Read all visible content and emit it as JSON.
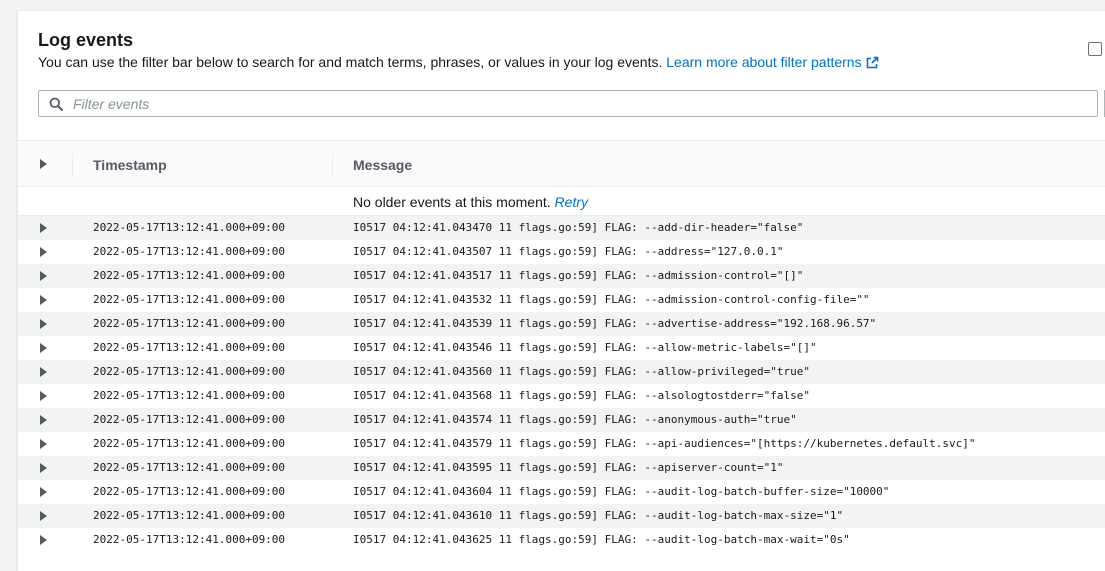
{
  "header": {
    "title": "Log events",
    "description": "You can use the filter bar below to search for and match terms, phrases, or values in your log events.",
    "learn_more": "Learn more about filter patterns"
  },
  "filter": {
    "placeholder": "Filter events",
    "value": ""
  },
  "table": {
    "columns": [
      "Timestamp",
      "Message"
    ],
    "notice": "No older events at this moment.",
    "retry": "Retry",
    "rows": [
      {
        "timestamp": "2022-05-17T13:12:41.000+09:00",
        "message": "I0517 04:12:41.043470 11 flags.go:59] FLAG: --add-dir-header=\"false\""
      },
      {
        "timestamp": "2022-05-17T13:12:41.000+09:00",
        "message": "I0517 04:12:41.043507 11 flags.go:59] FLAG: --address=\"127.0.0.1\""
      },
      {
        "timestamp": "2022-05-17T13:12:41.000+09:00",
        "message": "I0517 04:12:41.043517 11 flags.go:59] FLAG: --admission-control=\"[]\""
      },
      {
        "timestamp": "2022-05-17T13:12:41.000+09:00",
        "message": "I0517 04:12:41.043532 11 flags.go:59] FLAG: --admission-control-config-file=\"\""
      },
      {
        "timestamp": "2022-05-17T13:12:41.000+09:00",
        "message": "I0517 04:12:41.043539 11 flags.go:59] FLAG: --advertise-address=\"192.168.96.57\""
      },
      {
        "timestamp": "2022-05-17T13:12:41.000+09:00",
        "message": "I0517 04:12:41.043546 11 flags.go:59] FLAG: --allow-metric-labels=\"[]\""
      },
      {
        "timestamp": "2022-05-17T13:12:41.000+09:00",
        "message": "I0517 04:12:41.043560 11 flags.go:59] FLAG: --allow-privileged=\"true\""
      },
      {
        "timestamp": "2022-05-17T13:12:41.000+09:00",
        "message": "I0517 04:12:41.043568 11 flags.go:59] FLAG: --alsologtostderr=\"false\""
      },
      {
        "timestamp": "2022-05-17T13:12:41.000+09:00",
        "message": "I0517 04:12:41.043574 11 flags.go:59] FLAG: --anonymous-auth=\"true\""
      },
      {
        "timestamp": "2022-05-17T13:12:41.000+09:00",
        "message": "I0517 04:12:41.043579 11 flags.go:59] FLAG: --api-audiences=\"[https://kubernetes.default.svc]\""
      },
      {
        "timestamp": "2022-05-17T13:12:41.000+09:00",
        "message": "I0517 04:12:41.043595 11 flags.go:59] FLAG: --apiserver-count=\"1\""
      },
      {
        "timestamp": "2022-05-17T13:12:41.000+09:00",
        "message": "I0517 04:12:41.043604 11 flags.go:59] FLAG: --audit-log-batch-buffer-size=\"10000\""
      },
      {
        "timestamp": "2022-05-17T13:12:41.000+09:00",
        "message": "I0517 04:12:41.043610 11 flags.go:59] FLAG: --audit-log-batch-max-size=\"1\""
      },
      {
        "timestamp": "2022-05-17T13:12:41.000+09:00",
        "message": "I0517 04:12:41.043625 11 flags.go:59] FLAG: --audit-log-batch-max-wait=\"0s\""
      }
    ]
  },
  "colors": {
    "link": "#0073bb",
    "text": "#16191f",
    "header_text": "#545b64",
    "row_alt": "#f2f3f3"
  },
  "icons": {
    "search": "search-icon",
    "external_link": "external-link-icon",
    "expand": "caret-right-icon"
  }
}
